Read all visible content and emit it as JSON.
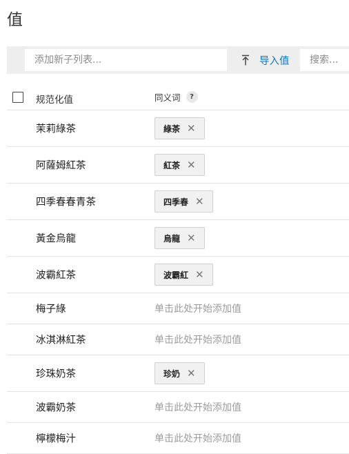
{
  "page": {
    "title": "值"
  },
  "toolbar": {
    "add_placeholder": "添加新子列表...",
    "import_label": "导入值",
    "search_placeholder": "搜索..."
  },
  "table": {
    "headers": {
      "reference": "规范化值",
      "synonyms": "同义词",
      "help": "?"
    },
    "empty_placeholder": "单击此处开始添加值",
    "rows": [
      {
        "value": "茉莉綠茶",
        "synonym": "綠茶"
      },
      {
        "value": "阿薩姆紅茶",
        "synonym": "紅茶"
      },
      {
        "value": "四季春春青茶",
        "synonym": "四季春"
      },
      {
        "value": "黃金烏龍",
        "synonym": "烏龍"
      },
      {
        "value": "波霸紅茶",
        "synonym": "波霸紅"
      },
      {
        "value": "梅子綠",
        "synonym": null
      },
      {
        "value": "冰淇淋紅茶",
        "synonym": null
      },
      {
        "value": "珍珠奶茶",
        "synonym": "珍奶"
      },
      {
        "value": "波霸奶茶",
        "synonym": null
      },
      {
        "value": "檸檬梅汁",
        "synonym": null
      }
    ]
  },
  "colors": {
    "accent": "#1a73b8",
    "toolbar_bg": "#eeeeee",
    "chip_bg": "#f1f1f1",
    "placeholder": "#9b9b9b"
  },
  "icons": {
    "import": "upload-arrow-icon",
    "chip_remove": "close-icon",
    "help": "help-icon"
  }
}
